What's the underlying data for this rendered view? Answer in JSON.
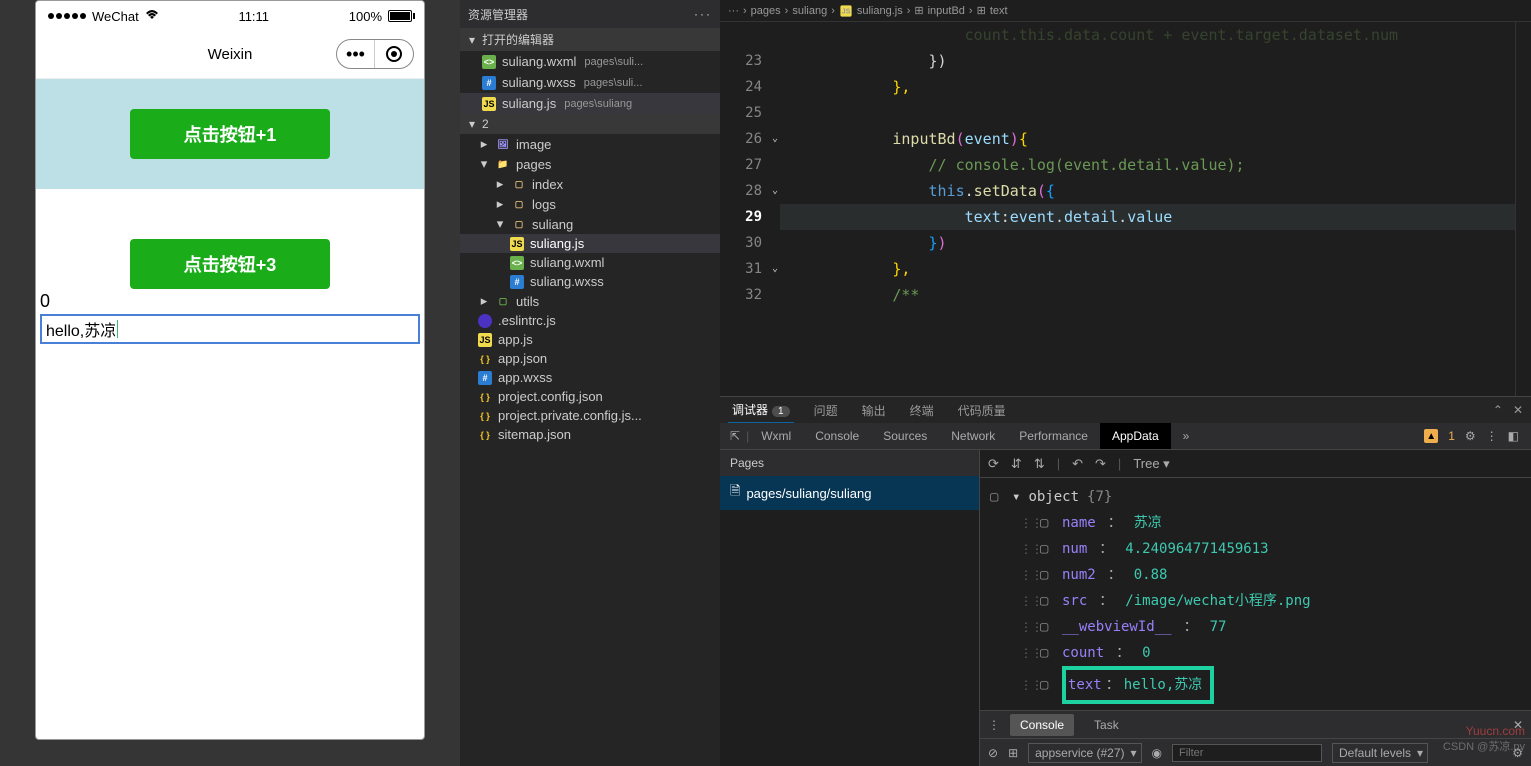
{
  "simulator": {
    "status": {
      "carrier": "WeChat",
      "time": "11:11",
      "battery": "100%"
    },
    "title": "Weixin",
    "button1": "点击按钮+1",
    "button2": "点击按钮+3",
    "countText": "0",
    "inputValue": "hello,苏凉"
  },
  "explorer": {
    "title": "资源管理器",
    "openEditors": "打开的编辑器",
    "openFiles": [
      {
        "name": "suliang.wxml",
        "path": "pages\\suli..."
      },
      {
        "name": "suliang.wxss",
        "path": "pages\\suli..."
      },
      {
        "name": "suliang.js",
        "path": "pages\\suliang"
      }
    ],
    "projectName": "2",
    "tree": {
      "image": "image",
      "pages": "pages",
      "index": "index",
      "logs": "logs",
      "suliang": "suliang",
      "suliang_js": "suliang.js",
      "suliang_wxml": "suliang.wxml",
      "suliang_wxss": "suliang.wxss",
      "utils": "utils",
      "eslintrc": ".eslintrc.js",
      "app_js": "app.js",
      "app_json": "app.json",
      "app_wxss": "app.wxss",
      "project_config": "project.config.json",
      "project_private": "project.private.config.js...",
      "sitemap": "sitemap.json"
    }
  },
  "breadcrumb": {
    "p1": "pages",
    "p2": "suliang",
    "p3": "suliang.js",
    "p4": "inputBd",
    "p5": "text"
  },
  "editor": {
    "topCut": "                    count.this.data.count + event.target.dataset.num",
    "lines": {
      "23": "                })",
      "24": "            },",
      "25": "",
      "26_a": "            ",
      "26_fn": "inputBd",
      "26_b": "(",
      "26_arg": "event",
      "26_c": ")",
      "26_d": "{",
      "27_a": "                ",
      "27_cmt": "// console.log(event.detail.value);",
      "28_a": "                ",
      "28_this": "this",
      "28_dot": ".",
      "28_fn": "setData",
      "28_b": "(",
      "28_c": "{",
      "29_a": "                    ",
      "29_key": "text",
      "29_colon": ":",
      "29_ev": "event",
      "29_d1": ".",
      "29_det": "detail",
      "29_d2": ".",
      "29_val": "value",
      "30_a": "                ",
      "30_b": "}",
      "30_c": ")",
      "31": "            },",
      "32_a": "            ",
      "32_cmt": "/**"
    },
    "lineNumbers": [
      "23",
      "24",
      "25",
      "26",
      "27",
      "28",
      "29",
      "30",
      "31",
      "32"
    ]
  },
  "bottomTabs": {
    "debugger": "调试器",
    "badge": "1",
    "problems": "问题",
    "output": "输出",
    "terminal": "终端",
    "quality": "代码质量"
  },
  "devtools": {
    "tabs": {
      "wxml": "Wxml",
      "console": "Console",
      "sources": "Sources",
      "network": "Network",
      "performance": "Performance",
      "appdata": "AppData",
      "more": "»"
    },
    "warnCount": "1",
    "pagesLabel": "Pages",
    "pagePath": "pages/suliang/suliang",
    "treeLabel": "Tree",
    "objectLabel": "object",
    "objectCount": "{7}",
    "data": {
      "name_key": "name",
      "name_val": "苏凉",
      "num_key": "num",
      "num_val": "4.240964771459613",
      "num2_key": "num2",
      "num2_val": "0.88",
      "src_key": "src",
      "src_val": "/image/wechat小程序.png",
      "webview_key": "__webviewId__",
      "webview_val": "77",
      "count_key": "count",
      "count_val": "0",
      "text_key": "text",
      "text_val": "hello,苏凉"
    },
    "consoleTab": "Console",
    "taskTab": "Task",
    "contextLabel": "appservice (#27)",
    "filterPlaceholder": "Filter",
    "levelsLabel": "Default levels"
  },
  "watermark": {
    "top": "Yuucn.com",
    "bottom": "CSDN @苏凉.py"
  }
}
